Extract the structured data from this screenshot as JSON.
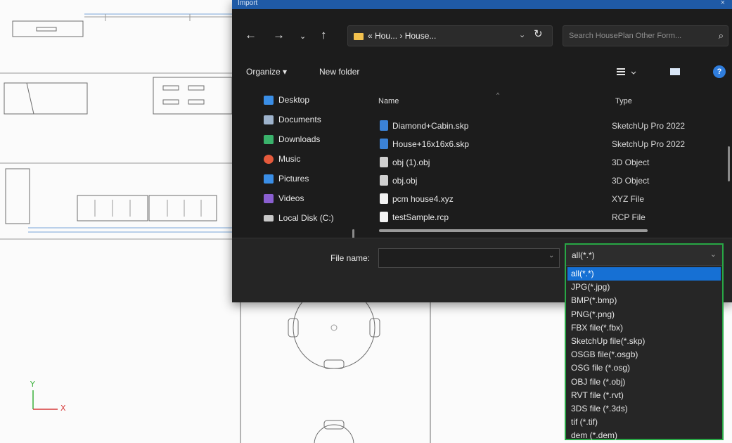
{
  "dialog": {
    "title": "Import",
    "close_glyph": "×"
  },
  "address": {
    "path": "« Hou... › House...",
    "search_placeholder": "Search HousePlan Other Form..."
  },
  "toolbar": {
    "organize": "Organize ▾",
    "new_folder": "New folder"
  },
  "nav": {
    "items": [
      {
        "label": "Desktop",
        "color": "#3a8ee6"
      },
      {
        "label": "Documents",
        "color": "#9eb3cc"
      },
      {
        "label": "Downloads",
        "color": "#3ab26b"
      },
      {
        "label": "Music",
        "color": "#e55a3c"
      },
      {
        "label": "Pictures",
        "color": "#3a8ee6"
      },
      {
        "label": "Videos",
        "color": "#8a5fd1"
      },
      {
        "label": "Local Disk (C:)",
        "color": "#c8c8c8"
      }
    ]
  },
  "files": {
    "col_name": "Name",
    "col_type": "Type",
    "rows": [
      {
        "name": "Diamond+Cabin.skp",
        "type": "SketchUp Pro 2022",
        "color": "#3b82d6"
      },
      {
        "name": "House+16x16x6.skp",
        "type": "SketchUp Pro 2022",
        "color": "#3b82d6"
      },
      {
        "name": "obj (1).obj",
        "type": "3D Object",
        "color": "#cfcfcf"
      },
      {
        "name": "obj.obj",
        "type": "3D Object",
        "color": "#cfcfcf"
      },
      {
        "name": "pcm house4.xyz",
        "type": "XYZ File",
        "color": "#f2f2f2"
      },
      {
        "name": "testSample.rcp",
        "type": "RCP File",
        "color": "#f2f2f2"
      }
    ]
  },
  "bottom": {
    "file_name_label": "File name:",
    "file_name_value": ""
  },
  "filter": {
    "selected": "all(*.*)",
    "options": [
      "all(*.*)",
      "JPG(*.jpg)",
      "BMP(*.bmp)",
      "PNG(*.png)",
      "FBX file(*.fbx)",
      "SketchUp file(*.skp)",
      "OSGB file(*.osgb)",
      "OSG file (*.osg)",
      "OBJ file (*.obj)",
      "RVT file (*.rvt)",
      "3DS file (*.3ds)",
      "tif (*.tif)",
      "dem (*.dem)"
    ]
  },
  "axis": {
    "x_label": "X",
    "y_label": "Y"
  },
  "colors": {
    "dialog_bg": "#1c1c1c",
    "accent": "#1670d4",
    "highlight_border": "#28a745"
  }
}
